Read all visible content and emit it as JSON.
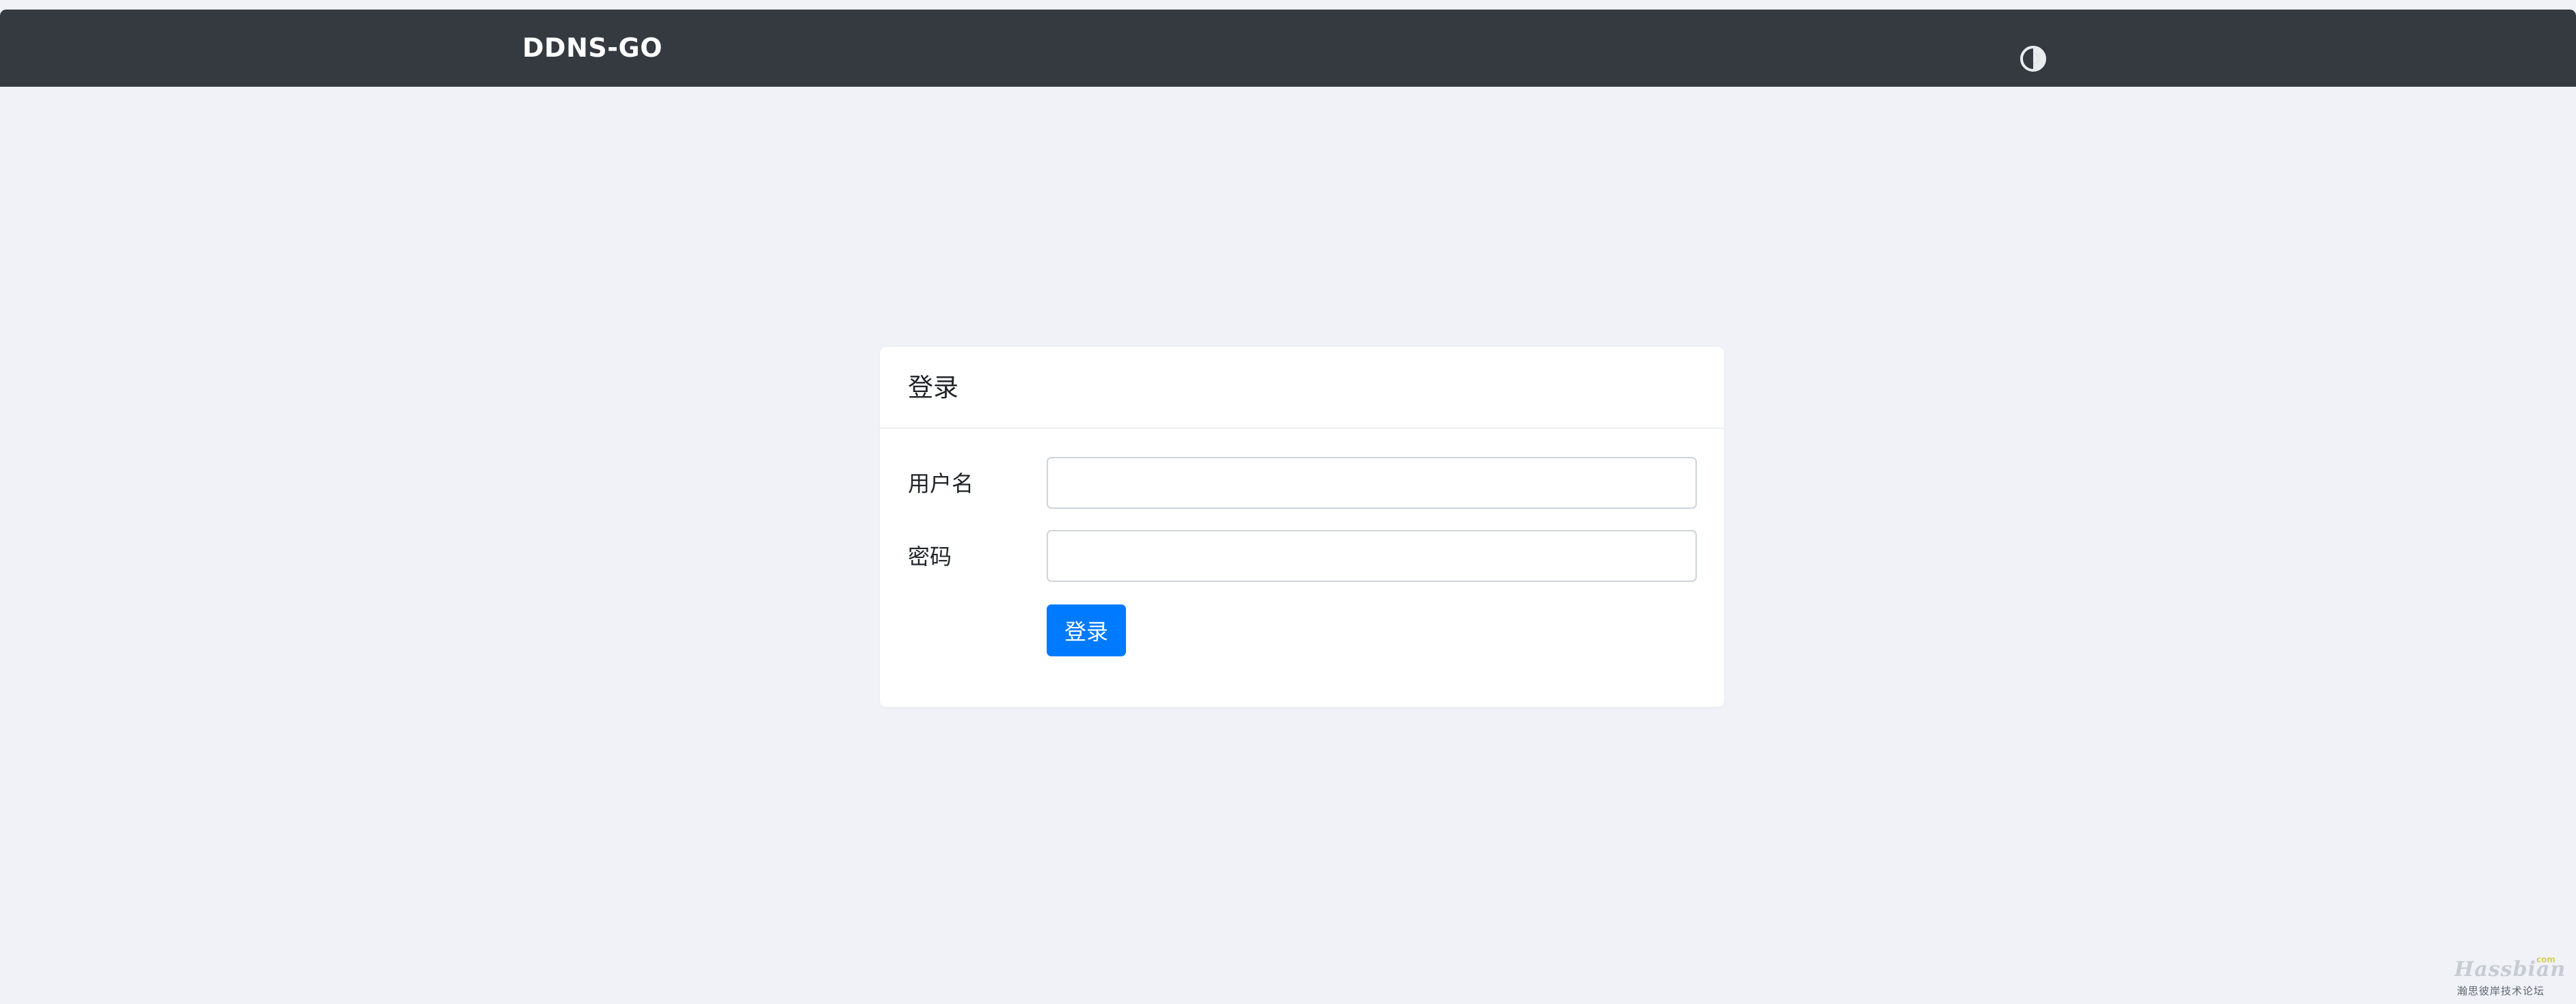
{
  "navbar": {
    "brand": "DDNS-GO",
    "theme_toggle_icon": "theme-toggle-icon"
  },
  "login_card": {
    "title": "登录",
    "username_label": "用户名",
    "username_value": "",
    "password_label": "密码",
    "password_value": "",
    "submit_label": "登录"
  },
  "watermark": {
    "main": "Hassbian",
    "suffix": "com",
    "sub": "瀚思彼岸技术论坛"
  },
  "colors": {
    "navbar_bg": "#343a40",
    "page_bg": "#f0f2f7",
    "primary": "#007bff"
  }
}
